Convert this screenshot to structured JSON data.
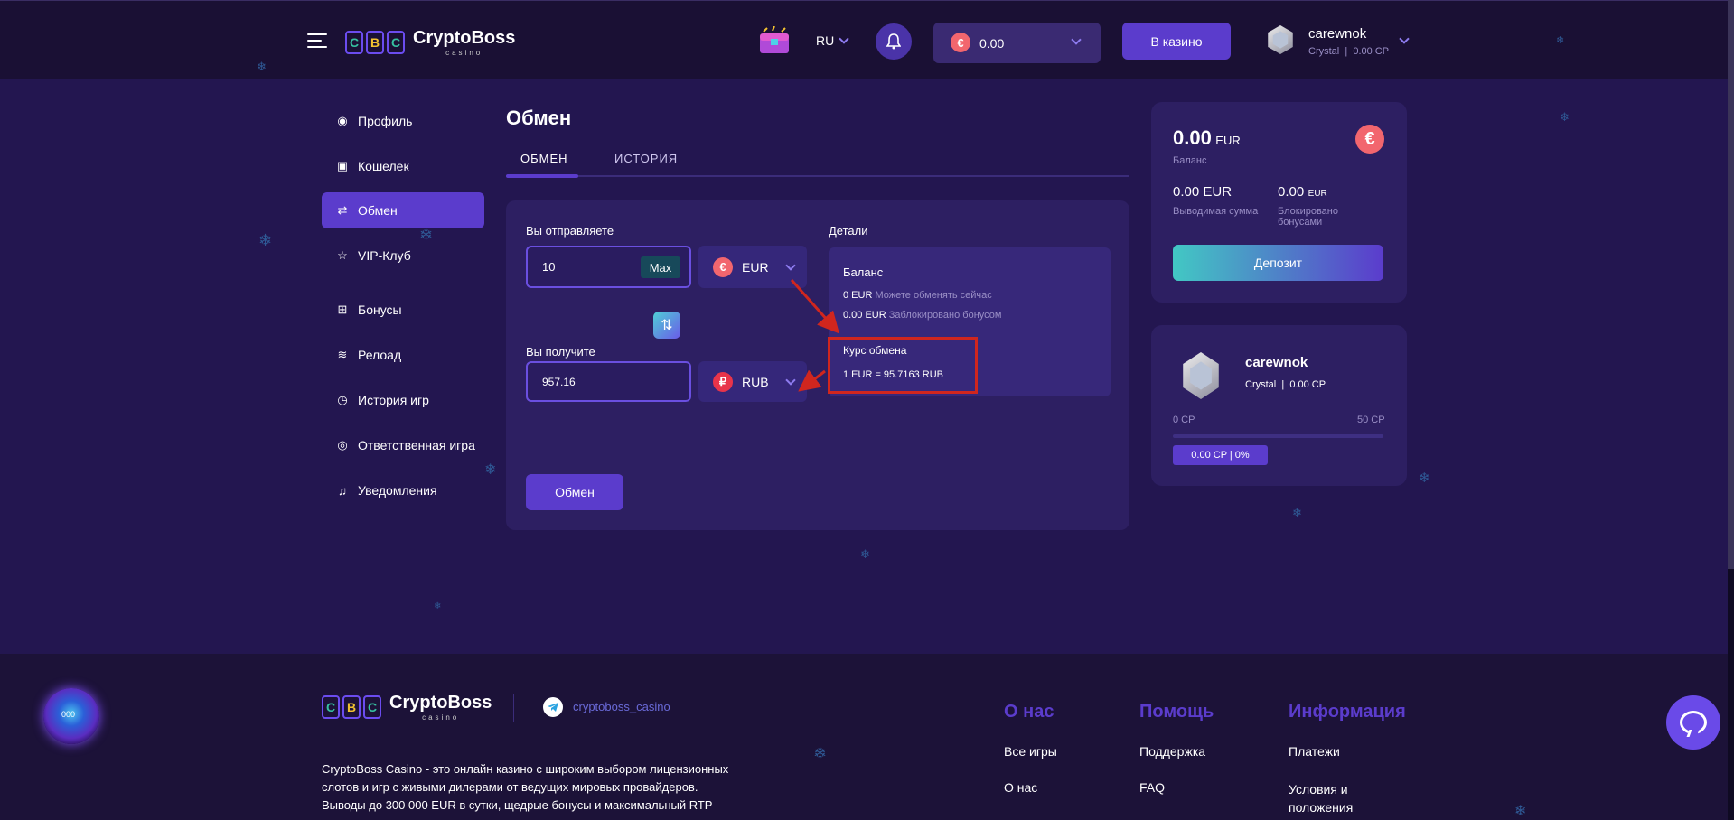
{
  "header": {
    "logo_text": "CryptoBoss",
    "logo_sub": "casino",
    "logo_letters": [
      "C",
      "B",
      "C"
    ],
    "lang": "RU",
    "balance": "0.00",
    "casino_button": "В казино",
    "username": "carewnok",
    "user_level": "Crystal",
    "user_cp": "0.00 CP"
  },
  "sidebar": {
    "items": [
      {
        "label": "Профиль",
        "icon": "user-circle-icon"
      },
      {
        "label": "Кошелек",
        "icon": "wallet-icon"
      },
      {
        "label": "Обмен",
        "icon": "exchange-icon",
        "active": true
      },
      {
        "label": "VIP-Клуб",
        "icon": "star-icon"
      },
      {
        "label": "Бонусы",
        "icon": "gift-icon"
      },
      {
        "label": "Релоад",
        "icon": "coins-icon"
      },
      {
        "label": "История игр",
        "icon": "clock-icon"
      },
      {
        "label": "Ответственная игра",
        "icon": "eye-icon"
      },
      {
        "label": "Уведомления",
        "icon": "bell-icon"
      }
    ]
  },
  "main": {
    "title": "Обмен",
    "tabs": [
      {
        "label": "ОБМЕН",
        "active": true
      },
      {
        "label": "ИСТОРИЯ",
        "active": false
      }
    ],
    "send_label": "Вы отправляете",
    "send_value": "10",
    "max_label": "Max",
    "send_currency": "EUR",
    "receive_label": "Вы получите",
    "receive_value": "957.16",
    "receive_currency": "RUB",
    "exchange_button": "Обмен",
    "details": {
      "title": "Детали",
      "balance_title": "Баланс",
      "available_amount": "0 EUR",
      "available_text": "Можете обменять сейчас",
      "locked_amount": "0.00 EUR",
      "locked_text": "Заблокировано бонусом",
      "rate_title": "Курс обмена",
      "rate_value": "1 EUR = 95.7163 RUB"
    }
  },
  "wallet_card": {
    "amount": "0.00",
    "currency": "EUR",
    "balance_label": "Баланс",
    "withdraw_amount": "0.00 EUR",
    "withdraw_label": "Выводимая сумма",
    "locked_amount": "0.00",
    "locked_currency": "EUR",
    "locked_label": "Блокировано бонусами",
    "deposit_button": "Депозит"
  },
  "vip_card": {
    "username": "carewnok",
    "level": "Crystal",
    "cp": "0.00 CP",
    "progress_min": "0 CP",
    "progress_max": "50 CP",
    "progress_badge": "0.00 CP | 0%",
    "progress_fraction": 0
  },
  "footer": {
    "logo_text": "CryptoBoss",
    "logo_sub": "casino",
    "telegram": "cryptoboss_casino",
    "description_lines": [
      "CryptoBoss Casino - это онлайн казино с широким выбором лицензионных",
      "слотов и игр с живыми дилерами от ведущих мировых провайдеров.",
      "Выводы до 300 000 EUR в сутки, щедрые бонусы и максимальный RTP"
    ],
    "columns": [
      {
        "title": "О нас",
        "links": [
          "Все игры",
          "О нас"
        ]
      },
      {
        "title": "Помощь",
        "links": [
          "Поддержка",
          "FAQ"
        ]
      },
      {
        "title": "Информация",
        "links": [
          "Платежи",
          "Условия и положения"
        ]
      }
    ],
    "orb_label": "000"
  },
  "colors": {
    "background": "#231650",
    "accent": "#5b3ccc",
    "header": "#1a1034",
    "annotation": "#d0261e"
  }
}
